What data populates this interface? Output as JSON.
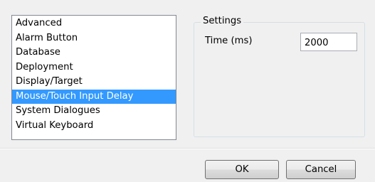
{
  "list": {
    "items": [
      {
        "label": "Advanced"
      },
      {
        "label": "Alarm Button"
      },
      {
        "label": "Database"
      },
      {
        "label": "Deployment"
      },
      {
        "label": "Display/Target"
      },
      {
        "label": "Mouse/Touch Input Delay"
      },
      {
        "label": "System Dialogues"
      },
      {
        "label": "Virtual Keyboard"
      }
    ],
    "selected_label": "Mouse/Touch Input Delay"
  },
  "settings": {
    "group_title": "Settings",
    "time_label": "Time (ms)",
    "time_value": "2000"
  },
  "buttons": {
    "ok_label": "OK",
    "cancel_label": "Cancel"
  },
  "colors": {
    "selection": "#3399ff",
    "dialog_background": "#f0f0f0"
  }
}
